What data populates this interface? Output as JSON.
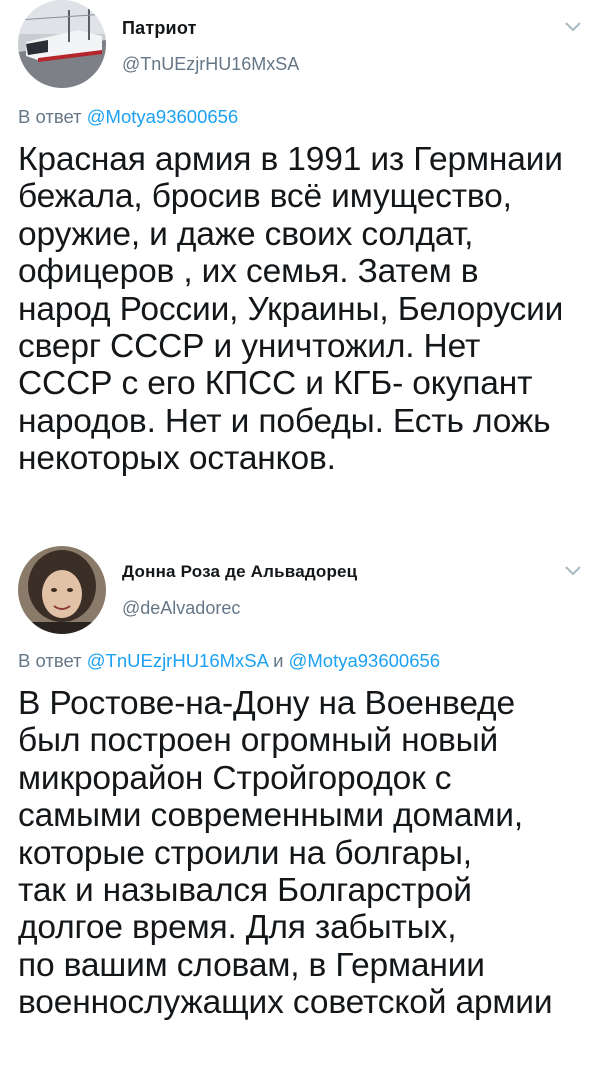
{
  "tweets": [
    {
      "display_name": "Патриот",
      "handle": "@TnUEzjrHU16MxSA",
      "reply_prefix": "В ответ",
      "reply_mentions": [
        "@Motya93600656"
      ],
      "reply_joiner": "",
      "avatar_icon": "train-photo-avatar",
      "body_lines": [
        "Красная армия в 1991 из Гермнаии",
        "бежала, бросив всё имущество,",
        "оружие, и даже своих солдат,",
        "офицеров , их семья. Затем в",
        "народ России, Украины, Белорусии",
        "сверг СССР и уничтожил. Нет",
        "СССР с его КПСС и КГБ- окупант",
        "народов. Нет и победы. Есть ложь",
        "некоторых останков."
      ]
    },
    {
      "display_name": "Донна Роза де Альвадорец",
      "handle": "@deAlvadorec",
      "reply_prefix": "В ответ",
      "reply_mentions": [
        "@TnUEzjrHU16MxSA",
        "@Motya93600656"
      ],
      "reply_joiner": "и",
      "avatar_icon": "person-photo-avatar",
      "body_lines": [
        "В Ростове-на-Дону на Военведе",
        "был построен огромный новый",
        "микрорайон Стройгородок с",
        "самыми современными домами,",
        "которые строили на болгары,",
        "так и назывался Болгарстрой",
        "долгое время. Для забытых,",
        "по вашим словам, в Германии",
        "военнослужащих советской армии"
      ]
    }
  ],
  "colors": {
    "text": "#14171a",
    "secondary": "#657786",
    "mention": "#1da1f2",
    "caret": "#aab8c2"
  },
  "icons": {
    "menu_caret": "chevron-down-icon"
  }
}
